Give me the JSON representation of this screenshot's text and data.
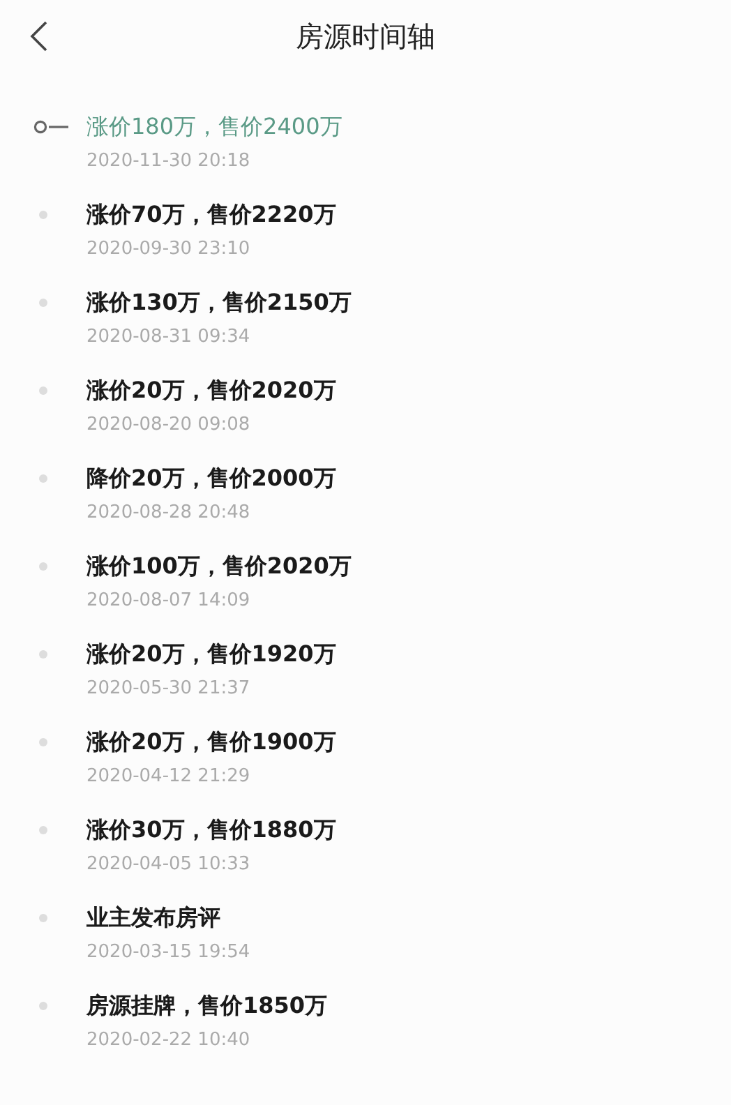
{
  "header": {
    "title": "房源时间轴"
  },
  "events": [
    {
      "text": "涨价180万，售价2400万",
      "time": "2020-11-30 20:18",
      "selected": true
    },
    {
      "text": "涨价70万，售价2220万",
      "time": "2020-09-30 23:10",
      "selected": false
    },
    {
      "text": "涨价130万，售价2150万",
      "time": "2020-08-31 09:34",
      "selected": false
    },
    {
      "text": "涨价20万，售价2020万",
      "time": "2020-08-20 09:08",
      "selected": false
    },
    {
      "text": "降价20万，售价2000万",
      "time": "2020-08-28 20:48",
      "selected": false
    },
    {
      "text": "涨价100万，售价2020万",
      "time": "2020-08-07 14:09",
      "selected": false
    },
    {
      "text": "涨价20万，售价1920万",
      "time": "2020-05-30 21:37",
      "selected": false
    },
    {
      "text": "涨价20万，售价1900万",
      "time": "2020-04-12 21:29",
      "selected": false
    },
    {
      "text": "涨价30万，售价1880万",
      "time": "2020-04-05 10:33",
      "selected": false
    },
    {
      "text": "业主发布房评",
      "time": "2020-03-15 19:54",
      "selected": false
    },
    {
      "text": "房源挂牌，售价1850万",
      "time": "2020-02-22 10:40",
      "selected": false
    }
  ]
}
